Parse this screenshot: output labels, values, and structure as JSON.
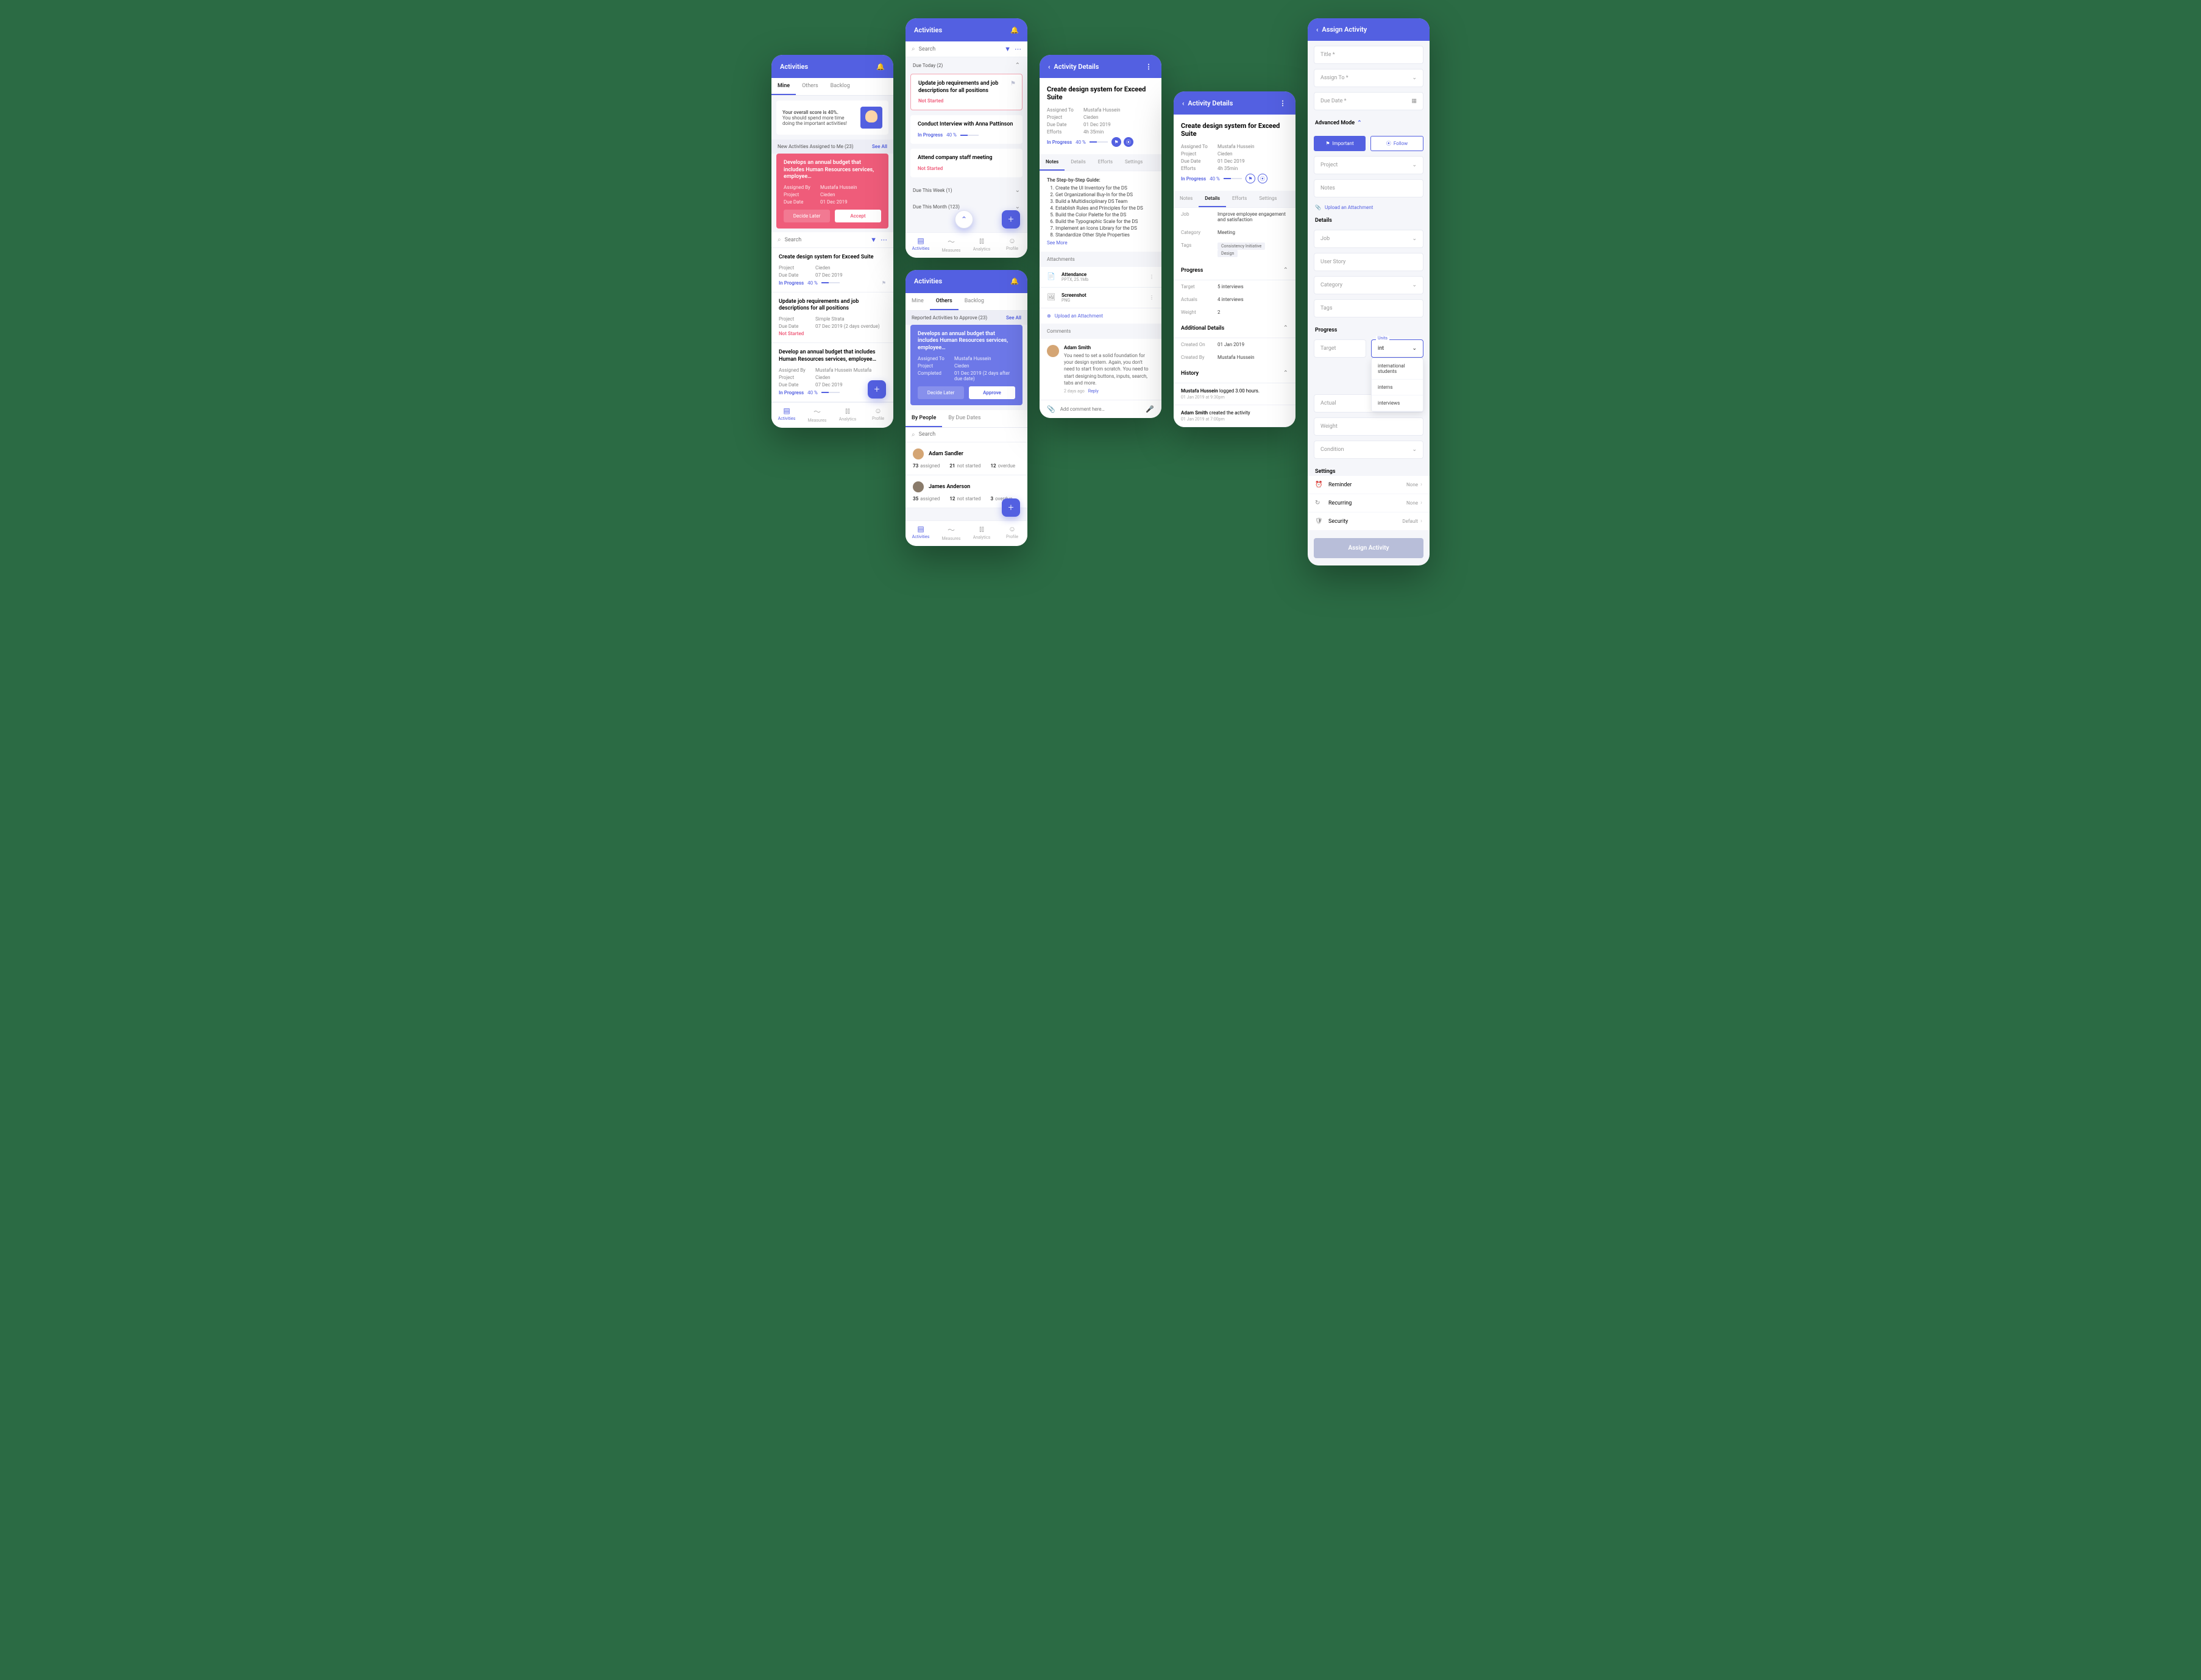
{
  "s1": {
    "title": "Activities",
    "tabs": [
      "Mine",
      "Others",
      "Backlog"
    ],
    "banner_l1": "Your overall score is 40%.",
    "banner_l2": "You should spend more time doing the important activities!",
    "newact": "New Activities Assigned to Me (23)",
    "see": "See All",
    "pink": {
      "title": "Develops an annual budget that includes Human Resources services, employee…",
      "by_l": "Assigned By",
      "by": "Mustafa Hussein",
      "pr_l": "Project",
      "pr": "Cieden",
      "dd_l": "Due Date",
      "dd": "01 Dec 2019",
      "b1": "Decide Later",
      "b2": "Accept"
    },
    "search": "Search",
    "card1": {
      "title": "Create design system for Exceed Suite",
      "pr": "Cieden",
      "dd": "07 Dec 2019",
      "st": "In Progress",
      "pct": "40 %"
    },
    "card2": {
      "title": "Update job requirements and job descriptions for all positions",
      "pr": "Simple Strata",
      "dd": "07 Dec 2019  (2 days overdue)",
      "st": "Not Started"
    },
    "card3": {
      "title": "Develop an annual budget that includes Human Resources services, employee…",
      "by": "Mustafa Hussein Mustafa",
      "pr": "Cieden",
      "dd": "07 Dec 2019",
      "st": "In Progress",
      "pct": "40 %"
    },
    "nav": [
      "Activities",
      "Measures",
      "Analytics",
      "Profile"
    ]
  },
  "s2": {
    "title": "Activities",
    "search": "Search",
    "g1": "Due Today (2)",
    "t1": {
      "title": "Update job requirements and job descriptions for all positions",
      "st": "Not Started"
    },
    "t2": {
      "title": "Conduct Interview with Anna Pattinson",
      "st": "In Progress",
      "pct": "40 %"
    },
    "t3": {
      "title": "Attend company staff meeting",
      "st": "Not Started"
    },
    "g2": "Due This Week (1)",
    "g3": "Due This Month (123)",
    "nav": [
      "Activities",
      "Measures",
      "Analytics",
      "Profile"
    ]
  },
  "s3": {
    "title": "Activities",
    "tabs": [
      "Mine",
      "Others",
      "Backlog"
    ],
    "rep": "Reported Activities to Approve (23)",
    "see": "See All",
    "blue": {
      "title": "Develops an annual budget that includes Human Resources services, employee…",
      "at_l": "Assigned To",
      "at": "Mustafa Hussein",
      "pr_l": "Project",
      "pr": "Cieden",
      "cm_l": "Completed",
      "cm": "01 Dec 2019  (2 days after due date)",
      "b1": "Decide Later",
      "b2": "Approve"
    },
    "sub": [
      "By People",
      "By Due Dates"
    ],
    "search": "Search",
    "p1": {
      "name": "Adam Sandler",
      "a": "73",
      "an": "21",
      "ov": "12"
    },
    "p2": {
      "name": "James Anderson",
      "a": "35",
      "an": "12",
      "ov": "3"
    },
    "assigned": "assigned",
    "notstarted": "not started",
    "overdue": "overdue",
    "nav": [
      "Activities",
      "Measures",
      "Analytics",
      "Profile"
    ]
  },
  "s4": {
    "title": "Activity Details",
    "dt": "Create design system for Exceed Suite",
    "at_l": "Assigned To",
    "at": "Mustafa Hussein",
    "pr_l": "Project",
    "pr": "Cieden",
    "dd_l": "Due Date",
    "dd": "01 Dec 2019",
    "ef_l": "Efforts",
    "ef": "4h 35min",
    "st": "In Progress",
    "pct": "40 %",
    "tabs": [
      "Notes",
      "Details",
      "Efforts",
      "Settings"
    ],
    "nt": "The Step-by-Step Guide:",
    "steps": [
      "Create the UI Inventory for the DS",
      "Get Organizational Buy-In for the DS",
      "Build a Multidisciplinary DS Team",
      "Establish Rules and Principles for the DS",
      "Build the Color Palette for the DS",
      "Build the Typographic Scale for the DS",
      "Implement an Icons Library for the DS",
      "Standardize Other Style Properties"
    ],
    "more": "See More",
    "att": "Attachments",
    "a1": {
      "name": "Attendance",
      "meta": "PPTX, 25.1Mb"
    },
    "a2": {
      "name": "Screenshot",
      "meta": "PNG"
    },
    "up": "Upload an Attachment",
    "com": "Comments",
    "c": {
      "name": "Adam Smith",
      "text": "You need to set a solid foundation for your design system. Again, you don't need to start from scratch. You need to start designing buttons, inputs, search, tabs and more.",
      "time": "2 days ago",
      "reply": "Reply"
    },
    "add": "Add comment here…"
  },
  "s5": {
    "title": "Activity Details",
    "dt": "Create design system for Exceed Suite",
    "at_l": "Assigned To",
    "at": "Mustafa Hussein",
    "pr_l": "Project",
    "pr": "Cieden",
    "dd_l": "Due Date",
    "dd": "01 Dec 2019",
    "ef_l": "Efforts",
    "ef": "4h 35min",
    "st": "In Progress",
    "pct": "40 %",
    "tabs": [
      "Notes",
      "Details",
      "Efforts",
      "Settings"
    ],
    "job_l": "Job",
    "job": "Improve employee engagement and satisfaction",
    "cat_l": "Category",
    "cat": "Meeting",
    "tags_l": "Tags",
    "tag1": "Consistency Initiative",
    "tag2": "Design",
    "prog": "Progress",
    "tg_l": "Target",
    "tg": "5 interviews",
    "ac_l": "Actuals",
    "ac": "4 interviews",
    "wt_l": "Weight",
    "wt": "2",
    "add": "Additional Details",
    "co_l": "Created On",
    "co": "01 Jan 2019",
    "cb_l": "Created By",
    "cb": "Mustafa Hussein",
    "hist": "History",
    "h1n": "Mustafa Hussein",
    "h1a": " logged 3.00 hours.",
    "h1t": "01 Jan 2019 at 9:30pm",
    "h2n": "Adam Smith",
    "h2a": " created the activity",
    "h2t": "01 Jan 2019 at 7:00pm"
  },
  "s6": {
    "title": "Assign Activity",
    "f1": "Title *",
    "f2": "Assign To *",
    "f3": "Due Date *",
    "adv": "Advanced Mode",
    "imp": "Important",
    "fol": "Follow",
    "f4": "Project",
    "f5": "Notes",
    "up": "Upload an Attachment",
    "det": "Details",
    "f6": "Job",
    "f7": "User Story",
    "f8": "Category",
    "f9": "Tags",
    "prog": "Progress",
    "tg": "Target",
    "un": "Units",
    "uv": "int",
    "ac": "Actual",
    "wt": "Weight",
    "cond": "Condition",
    "dd": [
      "international students",
      "interns",
      "interviews"
    ],
    "set": "Settings",
    "s1": "Reminder",
    "s2": "Recurring",
    "s3": "Security",
    "v1": "None",
    "v2": "None",
    "v3": "Default",
    "btn": "Assign Activity"
  }
}
